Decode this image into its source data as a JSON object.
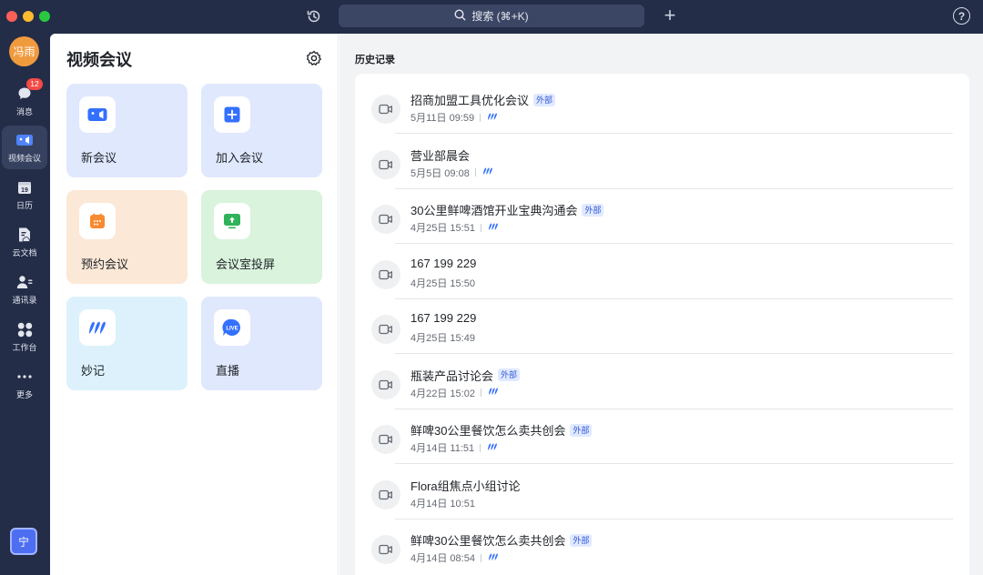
{
  "titlebar": {
    "search_label": "搜索 (⌘+K)",
    "plus_label": "+",
    "help_label": "?"
  },
  "user": {
    "avatar_text": "冯雨",
    "bottom_avatar_text": "宁"
  },
  "nav": {
    "items": [
      {
        "label": "消息",
        "icon": "chat-bubble-icon",
        "badge": "12"
      },
      {
        "label": "视频会议",
        "icon": "video-camera-icon",
        "active": true
      },
      {
        "label": "日历",
        "icon": "calendar-icon",
        "day": "19"
      },
      {
        "label": "云文档",
        "icon": "cloud-doc-icon"
      },
      {
        "label": "通讯录",
        "icon": "contacts-icon"
      },
      {
        "label": "工作台",
        "icon": "workplace-grid-icon"
      },
      {
        "label": "更多",
        "icon": "more-dots-icon"
      }
    ]
  },
  "panel": {
    "title": "视频会议",
    "tiles": [
      {
        "label": "新会议",
        "icon": "video-camera-icon",
        "bg": "#e0e8fd"
      },
      {
        "label": "加入会议",
        "icon": "plus-square-icon",
        "bg": "#e0e8fd"
      },
      {
        "label": "预约会议",
        "icon": "calendar-schedule-icon",
        "bg": "#fce8d6"
      },
      {
        "label": "会议室投屏",
        "icon": "screen-cast-icon",
        "bg": "#daf3dc"
      },
      {
        "label": "妙记",
        "icon": "minutes-icon",
        "bg": "#dcf1fb"
      },
      {
        "label": "直播",
        "icon": "live-icon",
        "bg": "#e0e8fd"
      }
    ]
  },
  "history": {
    "title": "历史记录",
    "external_tag": "外部",
    "rows": [
      {
        "title": "招商加盟工具优化会议",
        "time": "5月11日 09:59",
        "external": true,
        "minutes": true
      },
      {
        "title": "营业部晨会",
        "time": "5月5日 09:08",
        "external": false,
        "minutes": true
      },
      {
        "title": "30公里鲜啤酒馆开业宝典沟通会",
        "time": "4月25日 15:51",
        "external": true,
        "minutes": true
      },
      {
        "title": "167 199 229",
        "time": "4月25日 15:50",
        "external": false,
        "minutes": false
      },
      {
        "title": "167 199 229",
        "time": "4月25日 15:49",
        "external": false,
        "minutes": false
      },
      {
        "title": "瓶装产品讨论会",
        "time": "4月22日 15:02",
        "external": true,
        "minutes": true
      },
      {
        "title": "鲜啤30公里餐饮怎么卖共创会",
        "time": "4月14日 11:51",
        "external": true,
        "minutes": true
      },
      {
        "title": "Flora组焦点小组讨论",
        "time": "4月14日 10:51",
        "external": false,
        "minutes": false
      },
      {
        "title": "鲜啤30公里餐饮怎么卖共创会",
        "time": "4月14日 08:54",
        "external": true,
        "minutes": true
      }
    ]
  },
  "colors": {
    "accent": "#3370ff",
    "rail_bg": "#232d48",
    "active_nav": "#36415f",
    "badge_red": "#f54a45"
  }
}
